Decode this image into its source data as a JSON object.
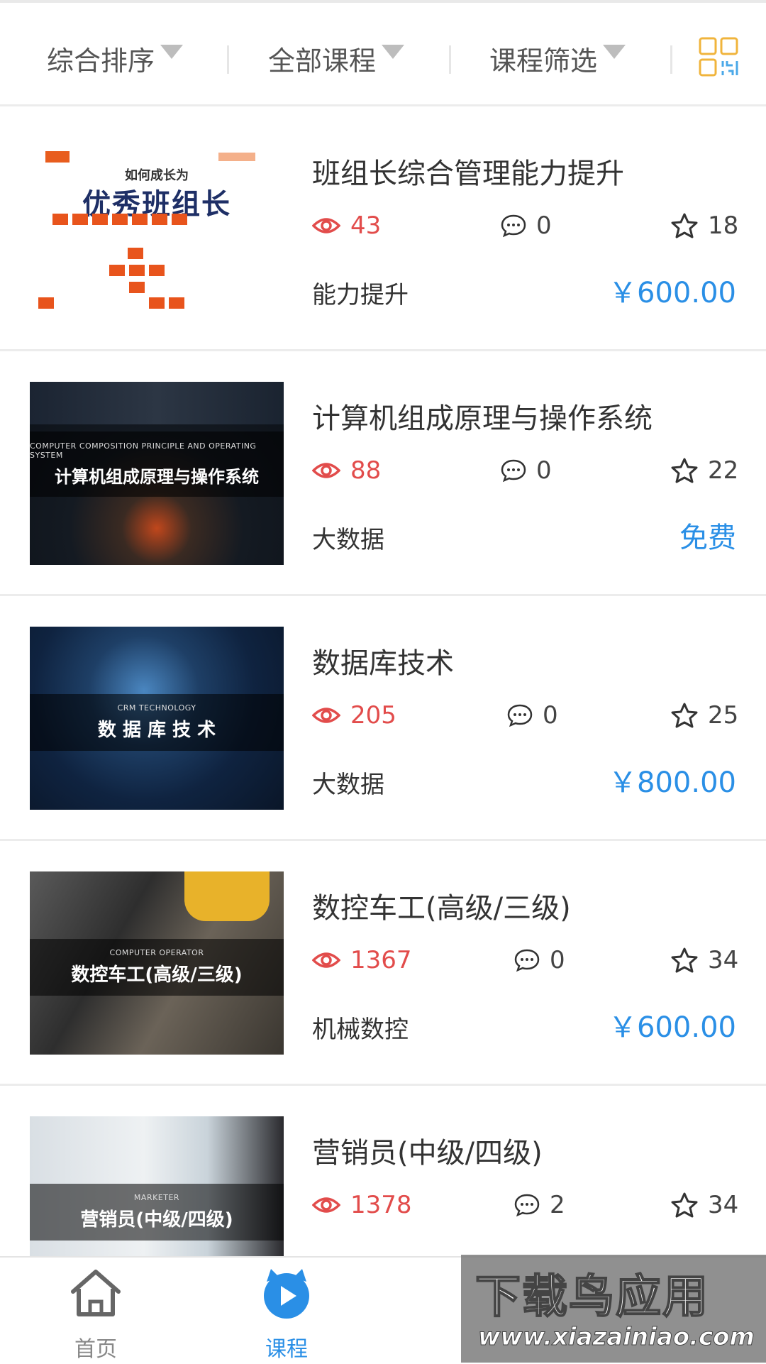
{
  "filters": {
    "sort": "综合排序",
    "courses": "全部课程",
    "filter": "课程筛选"
  },
  "colors": {
    "accent": "#2a8fe6",
    "views": "#e24c4b",
    "grid_icon": "#f0b43c"
  },
  "courses": [
    {
      "title": "班组长综合管理能力提升",
      "views": "43",
      "comments": "0",
      "favorites": "18",
      "category": "能力提升",
      "price": "￥600.00",
      "thumb": {
        "top": "如何成长为",
        "main": "优秀班组长"
      }
    },
    {
      "title": "计算机组成原理与操作系统",
      "views": "88",
      "comments": "0",
      "favorites": "22",
      "category": "大数据",
      "price": "免费",
      "thumb": {
        "sub": "COMPUTER COMPOSITION PRINCIPLE AND OPERATING SYSTEM",
        "main": "计算机组成原理与操作系统"
      }
    },
    {
      "title": "数据库技术",
      "views": "205",
      "comments": "0",
      "favorites": "25",
      "category": "大数据",
      "price": "￥800.00",
      "thumb": {
        "sub": "CRM TECHNOLOGY",
        "main": "数 据 库 技 术"
      }
    },
    {
      "title": "数控车工(高级/三级)",
      "views": "1367",
      "comments": "0",
      "favorites": "34",
      "category": "机械数控",
      "price": "￥600.00",
      "thumb": {
        "sub": "COMPUTER OPERATOR",
        "main": "数控车工(高级/三级)"
      }
    },
    {
      "title": "营销员(中级/四级)",
      "views": "1378",
      "comments": "2",
      "favorites": "34",
      "category": "",
      "price": "",
      "thumb": {
        "sub": "MARKETER",
        "main": "营销员(中级/四级)"
      }
    }
  ],
  "tabbar": {
    "home": "首页",
    "courses": "课程"
  },
  "watermark": {
    "big": "下载鸟应用",
    "url": "www.xiazainiao.com"
  }
}
